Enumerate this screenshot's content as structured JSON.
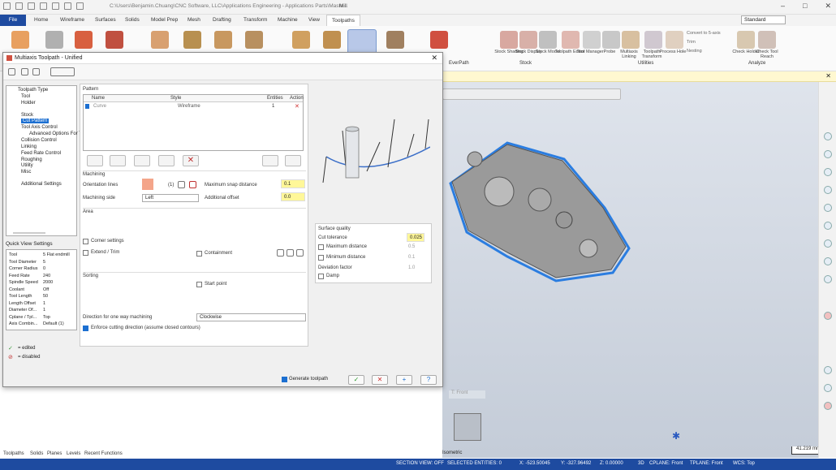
{
  "window": {
    "path": "C:\\Users\\Benjamin.Chuang\\CNC Software, LLC\\Applications Engineering - Applications Parts\\Maste...",
    "app": "Mill",
    "standard": "Standard"
  },
  "tabs": [
    "File",
    "Home",
    "Wireframe",
    "Surfaces",
    "Solids",
    "Model Prep",
    "Mesh",
    "Drafting",
    "Transform",
    "Machine",
    "View",
    "Toolpaths"
  ],
  "ribbon": {
    "groups": [
      "EverPath",
      "Stock",
      "Utilities",
      "Analyze"
    ],
    "stock_buttons": [
      "Stock Shading",
      "Stock Display",
      "Stock Model"
    ],
    "utility_buttons": [
      "Toolpath Editor",
      "Tool Manager",
      "Probe",
      "Multiaxis Linking",
      "Toolpath Transform",
      "Process Hole"
    ],
    "utility_small": [
      "Convert to 5-axis",
      "Trim",
      "Nesting"
    ],
    "analyze_buttons": [
      "Check Holder",
      "Check Tool Reach"
    ]
  },
  "dialog": {
    "title": "Multiaxis Toolpath - Unified",
    "tree": [
      "Toolpath Type",
      "Tool",
      "Holder",
      "Stock",
      "Cut Pattern",
      "Tool Axis Control",
      "Advanced Options For T",
      "Collision Control",
      "Linking",
      "Feed Rate Control",
      "Roughing",
      "Utility",
      "Misc",
      "Additional Settings"
    ],
    "quick_view_title": "Quick View Settings",
    "quick_view": [
      {
        "k": "Tool",
        "v": "5 Flat endmill"
      },
      {
        "k": "Tool Diameter",
        "v": "5"
      },
      {
        "k": "Corner Radius",
        "v": "0"
      },
      {
        "k": "Feed Rate",
        "v": "240"
      },
      {
        "k": "Spindle Speed",
        "v": "2000"
      },
      {
        "k": "Coolant",
        "v": "Off"
      },
      {
        "k": "Tool Length",
        "v": "50"
      },
      {
        "k": "Length Offset",
        "v": "1"
      },
      {
        "k": "Diameter Of...",
        "v": "1"
      },
      {
        "k": "Cplane / Tpl...",
        "v": "Top"
      },
      {
        "k": "Axis Combin...",
        "v": "Default (1)"
      }
    ],
    "legend_edited": "= edited",
    "legend_disabled": "= disabled",
    "pattern_label": "Pattern",
    "pattern_headers": [
      "Name",
      "Style",
      "Entities",
      "Action"
    ],
    "pattern_row": {
      "name": "Curve",
      "style": "Wireframe",
      "entities": "1"
    },
    "machining_label": "Machining",
    "orientation_lines": "Orientation lines",
    "orientation_count": "(1)",
    "machining_side": "Machining side",
    "machining_side_value": "Left",
    "max_snap": "Maximum snap distance",
    "max_snap_value": "0.1",
    "add_offset": "Additional offset",
    "add_offset_value": "0.0",
    "area_label": "Area",
    "corner_settings": "Corner settings",
    "extend_trim": "Extend / Trim",
    "containment": "Containment",
    "sorting_label": "Sorting",
    "start_point": "Start point",
    "direction_label": "Direction for one way machining",
    "direction_value": "Clockwise",
    "enforce": "Enforce cutting direction (assume closed contours)",
    "surface_quality": "Surface quality",
    "cut_tolerance": "Cut tolerance",
    "cut_tolerance_value": "0.025",
    "max_distance": "Maximum distance",
    "max_distance_value": "0.5",
    "min_distance": "Minimum distance",
    "min_distance_value": "0.1",
    "deviation_factor": "Deviation factor",
    "deviation_factor_value": "1.0",
    "damp": "Damp",
    "generate_toolpath": "Generate toolpath"
  },
  "viewport": {
    "tplane": "T: Front",
    "view_name": "Isometric",
    "scale": "41.219 mm"
  },
  "bottom_tabs": [
    "Toolpaths",
    "Solids",
    "Planes",
    "Levels",
    "Recent Functions"
  ],
  "status": {
    "section_view": "SECTION VIEW: OFF",
    "selected": "SELECTED ENTITIES: 0",
    "x": "X:  -523.50045",
    "y": "Y:  -327.96492",
    "z": "Z:  0.00000",
    "mode": "3D",
    "cplane": "CPLANE: Front",
    "tplane": "TPLANE: Front",
    "wcs": "WCS: Top"
  },
  "colors": {
    "accent": "#1e4ba0",
    "highlight": "#fff799",
    "selection": "#1c6fd1"
  }
}
